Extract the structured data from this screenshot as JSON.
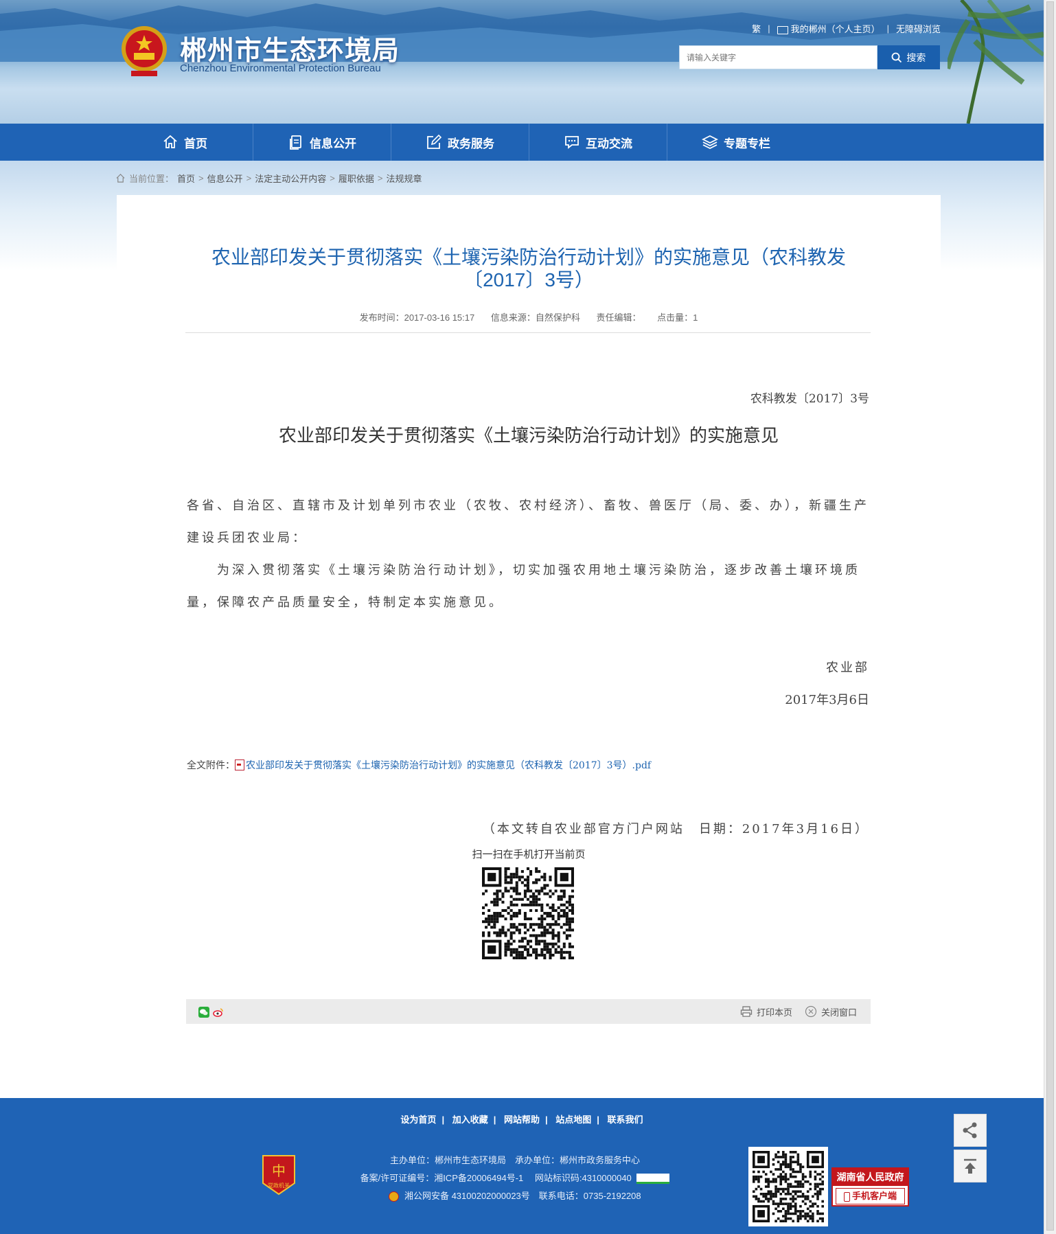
{
  "header": {
    "title": "郴州市生态环境局",
    "subtitle": "Chenzhou Environmental Protection Bureau",
    "top_links": [
      "繁",
      "我的郴州（个人主页）",
      "无障碍浏览"
    ],
    "search_placeholder": "请输入关键字",
    "search_button": "搜索"
  },
  "nav": {
    "items": [
      {
        "label": "首页",
        "icon": "home-icon"
      },
      {
        "label": "信息公开",
        "icon": "document-icon"
      },
      {
        "label": "政务服务",
        "icon": "edit-icon"
      },
      {
        "label": "互动交流",
        "icon": "chat-icon"
      },
      {
        "label": "专题专栏",
        "icon": "layers-icon"
      }
    ]
  },
  "breadcrumb": {
    "label": "当前位置：",
    "items": [
      "首页",
      "信息公开",
      "法定主动公开内容",
      "履职依据",
      "法规规章"
    ],
    "separator": ">"
  },
  "article": {
    "title_line1": "农业部印发关于贯彻落实《土壤污染防治行动计划》的实施意见（农科教发",
    "title_line2": "〔2017〕3号）",
    "meta": {
      "publish_time": "发布时间：2017-03-16 15:17",
      "source": "信息来源：自然保护科",
      "editor": "责任编辑：",
      "hits": "点击量：1"
    },
    "doc_number": "农科教发〔2017〕3号",
    "doc_heading": "农业部印发关于贯彻落实《土壤污染防治行动计划》的实施意见",
    "para1": "各省、自治区、直辖市及计划单列市农业（农牧、农村经济）、畜牧、兽医厅（局、委、办），新疆生产建设兵团农业局：",
    "para2": "为深入贯彻落实《土壤污染防治行动计划》，切实加强农用地土壤污染防治，逐步改善土壤环境质量，保障农产品质量安全，特制定本实施意见。",
    "signature": "农业部",
    "date": "2017年3月6日",
    "attachment_label": "全文附件：",
    "attachment_name": "农业部印发关于贯彻落实《土壤污染防治行动计划》的实施意见（农科教发〔2017〕3号）.pdf",
    "repost_note": "（本文转自农业部官方门户网站　日期：2017年3月16日）",
    "qr_caption": "扫一扫在手机打开当前页"
  },
  "tools": {
    "print": "打印本页",
    "close": "关闭窗口"
  },
  "footer": {
    "links": [
      "设为首页",
      "加入收藏",
      "网站帮助",
      "站点地图",
      "联系我们"
    ],
    "line1": "主办单位：郴州市生态环境局　承办单位：郴州市政务服务中心",
    "line2": "备案/许可证编号：湘ICP备20006494号-1　 网站标识码:4310000040",
    "line3": "湘公网安备 43100202000023号　联系电话：0735-2192208",
    "badge_text": "党政机关",
    "hunan_line1": "湖南省人民政府",
    "hunan_line2": "手机客户端"
  },
  "colors": {
    "brand_blue": "#1f63b5",
    "title_blue": "#1e64b0",
    "accent_red": "#c3171c"
  }
}
